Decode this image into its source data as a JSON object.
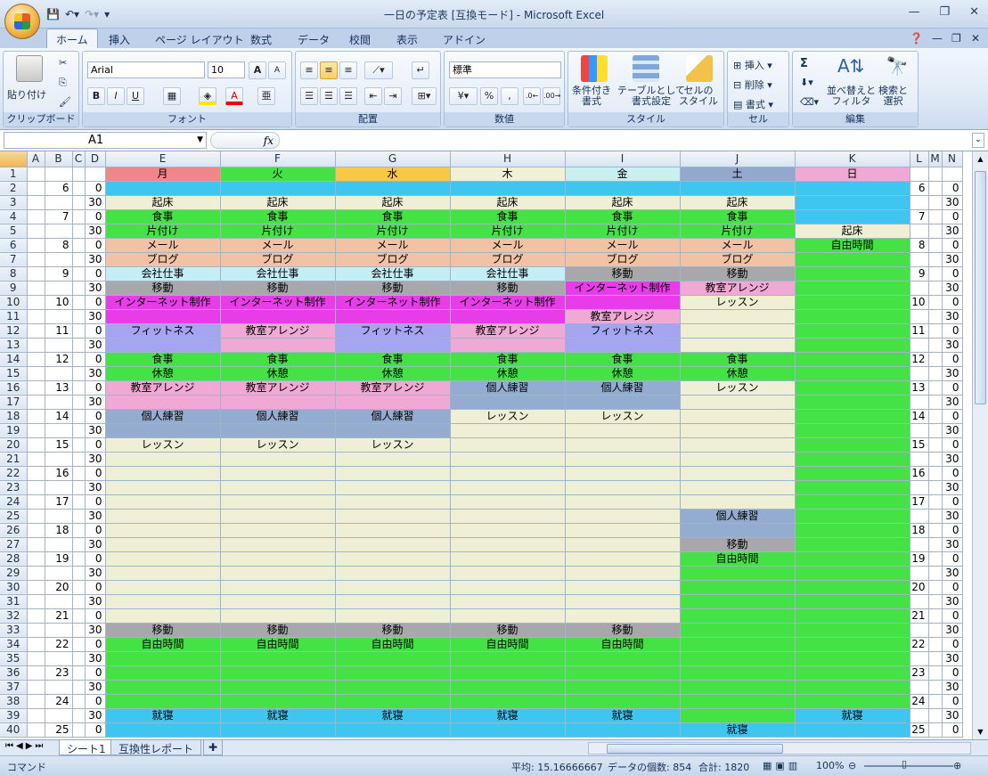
{
  "window": {
    "title": "一日の予定表 [互換モード] - Microsoft Excel",
    "minimize": "—",
    "restore": "❐",
    "close": "✕"
  },
  "ribbon_tabs": [
    "ホーム",
    "挿入",
    "ページ レイアウト",
    "数式",
    "データ",
    "校閲",
    "表示",
    "アドイン"
  ],
  "ribbon": {
    "clipboard": {
      "paste": "貼り付け",
      "label": "クリップボード"
    },
    "font": {
      "name": "Arial",
      "size": "10",
      "label": "フォント",
      "bold": "B",
      "italic": "I",
      "underline": "U",
      "grow": "A",
      "shrink": "A",
      "color_letter": "A"
    },
    "alignment": {
      "label": "配置"
    },
    "number": {
      "format": "標準",
      "label": "数値",
      "percent": "%",
      "comma": ","
    },
    "styles": {
      "cond": "条件付き\n書式",
      "table": "テーブルとして\n書式設定",
      "cell": "セルの\nスタイル",
      "label": "スタイル"
    },
    "cells": {
      "insert": "挿入",
      "delete": "削除",
      "format": "書式",
      "label": "セル"
    },
    "editing": {
      "sort": "並べ替えと\nフィルタ",
      "find": "検索と\n選択",
      "label": "編集",
      "sigma": "Σ"
    }
  },
  "formula_bar": {
    "name_box": "A1",
    "fx": "fx",
    "formula": ""
  },
  "columns": [
    "A",
    "B",
    "C",
    "D",
    "E",
    "F",
    "G",
    "H",
    "I",
    "J",
    "K",
    "L",
    "M",
    "N"
  ],
  "days": [
    "月",
    "火",
    "水",
    "木",
    "金",
    "土",
    "日"
  ],
  "hours": [
    6,
    7,
    8,
    9,
    10,
    11,
    12,
    13,
    14,
    15,
    16,
    17,
    18,
    19,
    20,
    21,
    22,
    23,
    24,
    25
  ],
  "schedule": [
    [
      "",
      "",
      "",
      "",
      "",
      "",
      ""
    ],
    [
      "起床",
      "起床",
      "起床",
      "起床",
      "起床",
      "起床",
      ""
    ],
    [
      "食事",
      "食事",
      "食事",
      "食事",
      "食事",
      "食事",
      ""
    ],
    [
      "片付け",
      "片付け",
      "片付け",
      "片付け",
      "片付け",
      "片付け",
      "起床"
    ],
    [
      "メール",
      "メール",
      "メール",
      "メール",
      "メール",
      "メール",
      "自由時間"
    ],
    [
      "ブログ",
      "ブログ",
      "ブログ",
      "ブログ",
      "ブログ",
      "ブログ",
      ""
    ],
    [
      "会社仕事",
      "会社仕事",
      "会社仕事",
      "会社仕事",
      "移動",
      "移動",
      ""
    ],
    [
      "移動",
      "移動",
      "移動",
      "移動",
      "インターネット制作",
      "教室アレンジ",
      ""
    ],
    [
      "インターネット制作",
      "インターネット制作",
      "インターネット制作",
      "インターネット制作",
      "",
      "レッスン",
      ""
    ],
    [
      "",
      "",
      "",
      "",
      "教室アレンジ",
      "",
      ""
    ],
    [
      "フィットネス",
      "教室アレンジ",
      "フィットネス",
      "教室アレンジ",
      "フィットネス",
      "",
      ""
    ],
    [
      "",
      "",
      "",
      "",
      "",
      "",
      ""
    ],
    [
      "食事",
      "食事",
      "食事",
      "食事",
      "食事",
      "食事",
      ""
    ],
    [
      "休憩",
      "休憩",
      "休憩",
      "休憩",
      "休憩",
      "休憩",
      ""
    ],
    [
      "教室アレンジ",
      "教室アレンジ",
      "教室アレンジ",
      "個人練習",
      "個人練習",
      "レッスン",
      ""
    ],
    [
      "",
      "",
      "",
      "",
      "",
      "",
      ""
    ],
    [
      "個人練習",
      "個人練習",
      "個人練習",
      "レッスン",
      "レッスン",
      "",
      ""
    ],
    [
      "",
      "",
      "",
      "",
      "",
      "",
      ""
    ],
    [
      "レッスン",
      "レッスン",
      "レッスン",
      "",
      "",
      "",
      ""
    ],
    [
      "",
      "",
      "",
      "",
      "",
      "",
      ""
    ],
    [
      "",
      "",
      "",
      "",
      "",
      "",
      ""
    ],
    [
      "",
      "",
      "",
      "",
      "",
      "",
      ""
    ],
    [
      "",
      "",
      "",
      "",
      "",
      "",
      ""
    ],
    [
      "",
      "",
      "",
      "",
      "",
      "個人練習",
      ""
    ],
    [
      "",
      "",
      "",
      "",
      "",
      "",
      ""
    ],
    [
      "",
      "",
      "",
      "",
      "",
      "移動",
      ""
    ],
    [
      "",
      "",
      "",
      "",
      "",
      "自由時間",
      ""
    ],
    [
      "",
      "",
      "",
      "",
      "",
      "",
      ""
    ],
    [
      "",
      "",
      "",
      "",
      "",
      "",
      ""
    ],
    [
      "",
      "",
      "",
      "",
      "",
      "",
      ""
    ],
    [
      "",
      "",
      "",
      "",
      "",
      "",
      ""
    ],
    [
      "移動",
      "移動",
      "移動",
      "移動",
      "移動",
      "",
      ""
    ],
    [
      "自由時間",
      "自由時間",
      "自由時間",
      "自由時間",
      "自由時間",
      "",
      ""
    ],
    [
      "",
      "",
      "",
      "",
      "",
      "",
      ""
    ],
    [
      "",
      "",
      "",
      "",
      "",
      "",
      ""
    ],
    [
      "",
      "",
      "",
      "",
      "",
      "",
      ""
    ],
    [
      "",
      "",
      "",
      "",
      "",
      "",
      ""
    ],
    [
      "就寝",
      "就寝",
      "就寝",
      "就寝",
      "就寝",
      "",
      "就寝"
    ],
    [
      "",
      "",
      "",
      "",
      "",
      "就寝",
      ""
    ]
  ],
  "colors": {
    "day_header": [
      "#f0858a",
      "#44e244",
      "#f6c845",
      "#f2f0d6",
      "#c9f0ee",
      "#92a8cc",
      "#f0a8d4"
    ],
    "cyan": "#3ec6f0",
    "cream": "#eeefd4",
    "green": "#44e244",
    "salmon": "#f2c2a4",
    "lightblue": "#c4eef6",
    "gray": "#a8a8ac",
    "magenta": "#e83ce8",
    "pink": "#f0a8d4",
    "lavender": "#a4a4f0",
    "steel": "#94acd0"
  },
  "sheets": [
    "シート1",
    "互換性レポート"
  ],
  "status": {
    "mode": "コマンド",
    "average": "平均: 15.16666667",
    "count": "データの個数: 854",
    "sum": "合計: 1820",
    "zoom": "100%"
  }
}
